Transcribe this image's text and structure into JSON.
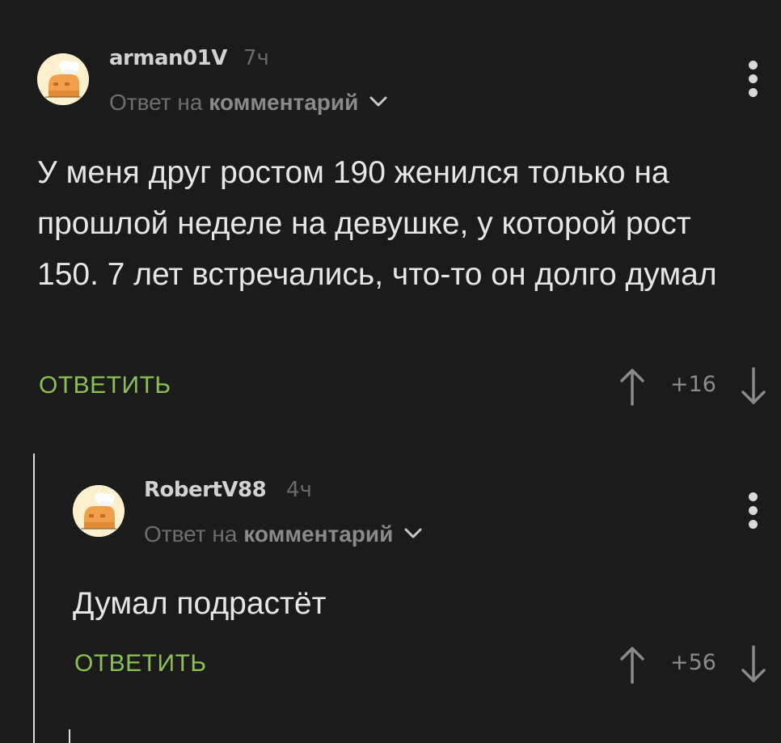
{
  "colors": {
    "background": "#1b1b1b",
    "accent_green": "#8cc152",
    "text_primary": "#e6e6e6",
    "text_muted": "#6e6e6e"
  },
  "comments": [
    {
      "author": "arman01V",
      "time": "7ч",
      "reply_prefix": "Ответ на",
      "reply_target": "комментарий",
      "text": "У меня друг ростом 190 женился только на прошлой неделе на девушке, у которой рост 150. 7 лет встречались, что-то он долго думал",
      "reply_label": "ОТВЕТИТЬ",
      "rating": "+16",
      "icons": [
        "avatar",
        "chevron-down-icon",
        "more-vertical-icon",
        "arrow-up-icon",
        "arrow-down-icon"
      ]
    },
    {
      "author": "RobertV88",
      "time": "4ч",
      "reply_prefix": "Ответ на",
      "reply_target": "комментарий",
      "text": "Думал подрастёт",
      "reply_label": "ОТВЕТИТЬ",
      "rating": "+56",
      "icons": [
        "avatar",
        "chevron-down-icon",
        "more-vertical-icon",
        "arrow-up-icon",
        "arrow-down-icon"
      ]
    }
  ]
}
